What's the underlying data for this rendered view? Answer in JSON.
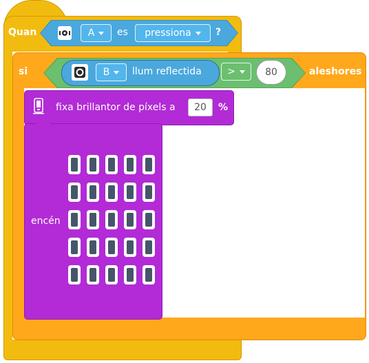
{
  "event_block": {
    "label": "Quan",
    "sensor_icon": "motion-sensor-icon",
    "port_value": "A",
    "connector_text": "es",
    "state_value": "pressiona",
    "help_text": "?"
  },
  "if_block": {
    "label": "si",
    "sensor_icon": "light-sensor-icon",
    "port_value": "B",
    "reporter_label": "llum reflectida",
    "operator_value": ">",
    "compare_value": "80",
    "then_label": "aleshores"
  },
  "brightness_block": {
    "icon": "pixel-display-icon",
    "label": "fixa brillantor de píxels a",
    "value": "20",
    "unit": "%"
  },
  "light_block": {
    "label": "encén",
    "grid_rows": 5,
    "grid_cols": 5
  },
  "colors": {
    "event": "#f2bb0f",
    "control": "#ffa81c",
    "sensor": "#4aa8dd",
    "operator": "#6bbf6f",
    "display": "#b22bd6"
  }
}
